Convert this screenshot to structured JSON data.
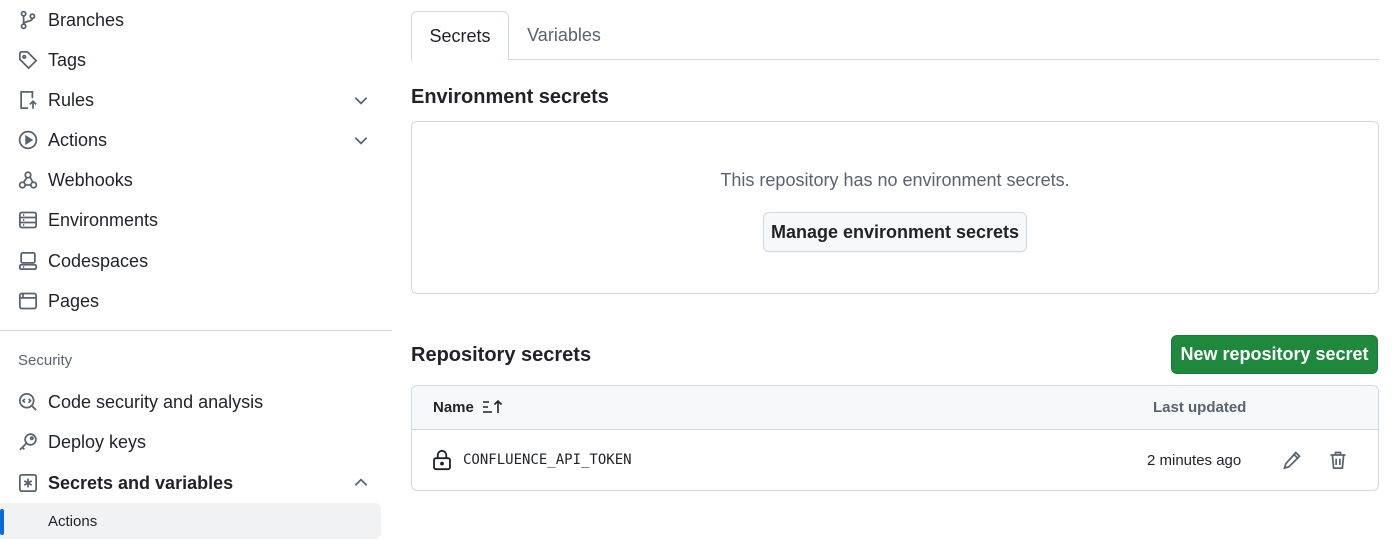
{
  "sidebar": {
    "items": [
      {
        "label": "Branches",
        "icon": "git-branch-icon"
      },
      {
        "label": "Tags",
        "icon": "tag-icon"
      },
      {
        "label": "Rules",
        "icon": "rules-icon"
      },
      {
        "label": "Actions",
        "icon": "play-icon"
      },
      {
        "label": "Webhooks",
        "icon": "webhook-icon"
      },
      {
        "label": "Environments",
        "icon": "server-icon"
      },
      {
        "label": "Codespaces",
        "icon": "codespaces-icon"
      },
      {
        "label": "Pages",
        "icon": "browser-icon"
      }
    ],
    "security_heading": "Security",
    "security_items": [
      {
        "label": "Code security and analysis",
        "icon": "codescan-icon"
      },
      {
        "label": "Deploy keys",
        "icon": "key-icon"
      },
      {
        "label": "Secrets and variables",
        "icon": "asterisk-icon"
      }
    ],
    "sub_item": "Actions"
  },
  "tabs": {
    "secrets": "Secrets",
    "variables": "Variables"
  },
  "env_secrets": {
    "title": "Environment secrets",
    "empty_message": "This repository has no environment secrets.",
    "manage_button": "Manage environment secrets"
  },
  "repo_secrets": {
    "title": "Repository secrets",
    "new_button": "New repository secret",
    "col_name": "Name",
    "col_updated": "Last updated",
    "rows": [
      {
        "name": "CONFLUENCE_API_TOKEN",
        "updated": "2 minutes ago"
      }
    ]
  },
  "colors": {
    "accent": "#0969da",
    "primary_button": "#1f883d"
  }
}
